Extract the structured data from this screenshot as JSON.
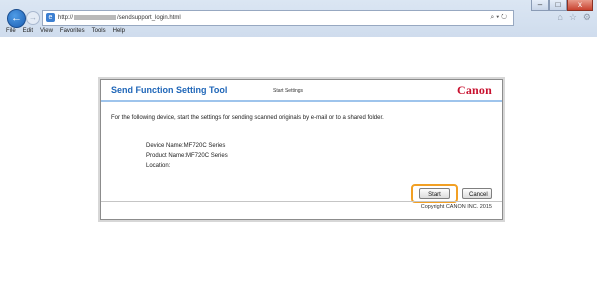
{
  "browser": {
    "url_prefix": "http://",
    "url_suffix": "/sendsupport_login.html",
    "menu": [
      "File",
      "Edit",
      "View",
      "Favorites",
      "Tools",
      "Help"
    ],
    "window_buttons": [
      "–",
      "□",
      "x"
    ]
  },
  "dialog": {
    "title": "Send Function Setting Tool",
    "subtitle": "Start Settings",
    "logo": "Canon",
    "instruction": "For the following device, start the settings for sending scanned originals by e-mail or to a shared folder.",
    "device_name": "Device Name:MF720C Series",
    "product_name": "Product Name:MF720C Series",
    "location": "Location:",
    "start_label": "Start",
    "cancel_label": "Cancel",
    "copyright": "Copyright CANON INC. 2015"
  },
  "colors": {
    "title_blue": "#1f66b8",
    "canon_red": "#c8102e",
    "highlight_orange": "#f2a024"
  }
}
